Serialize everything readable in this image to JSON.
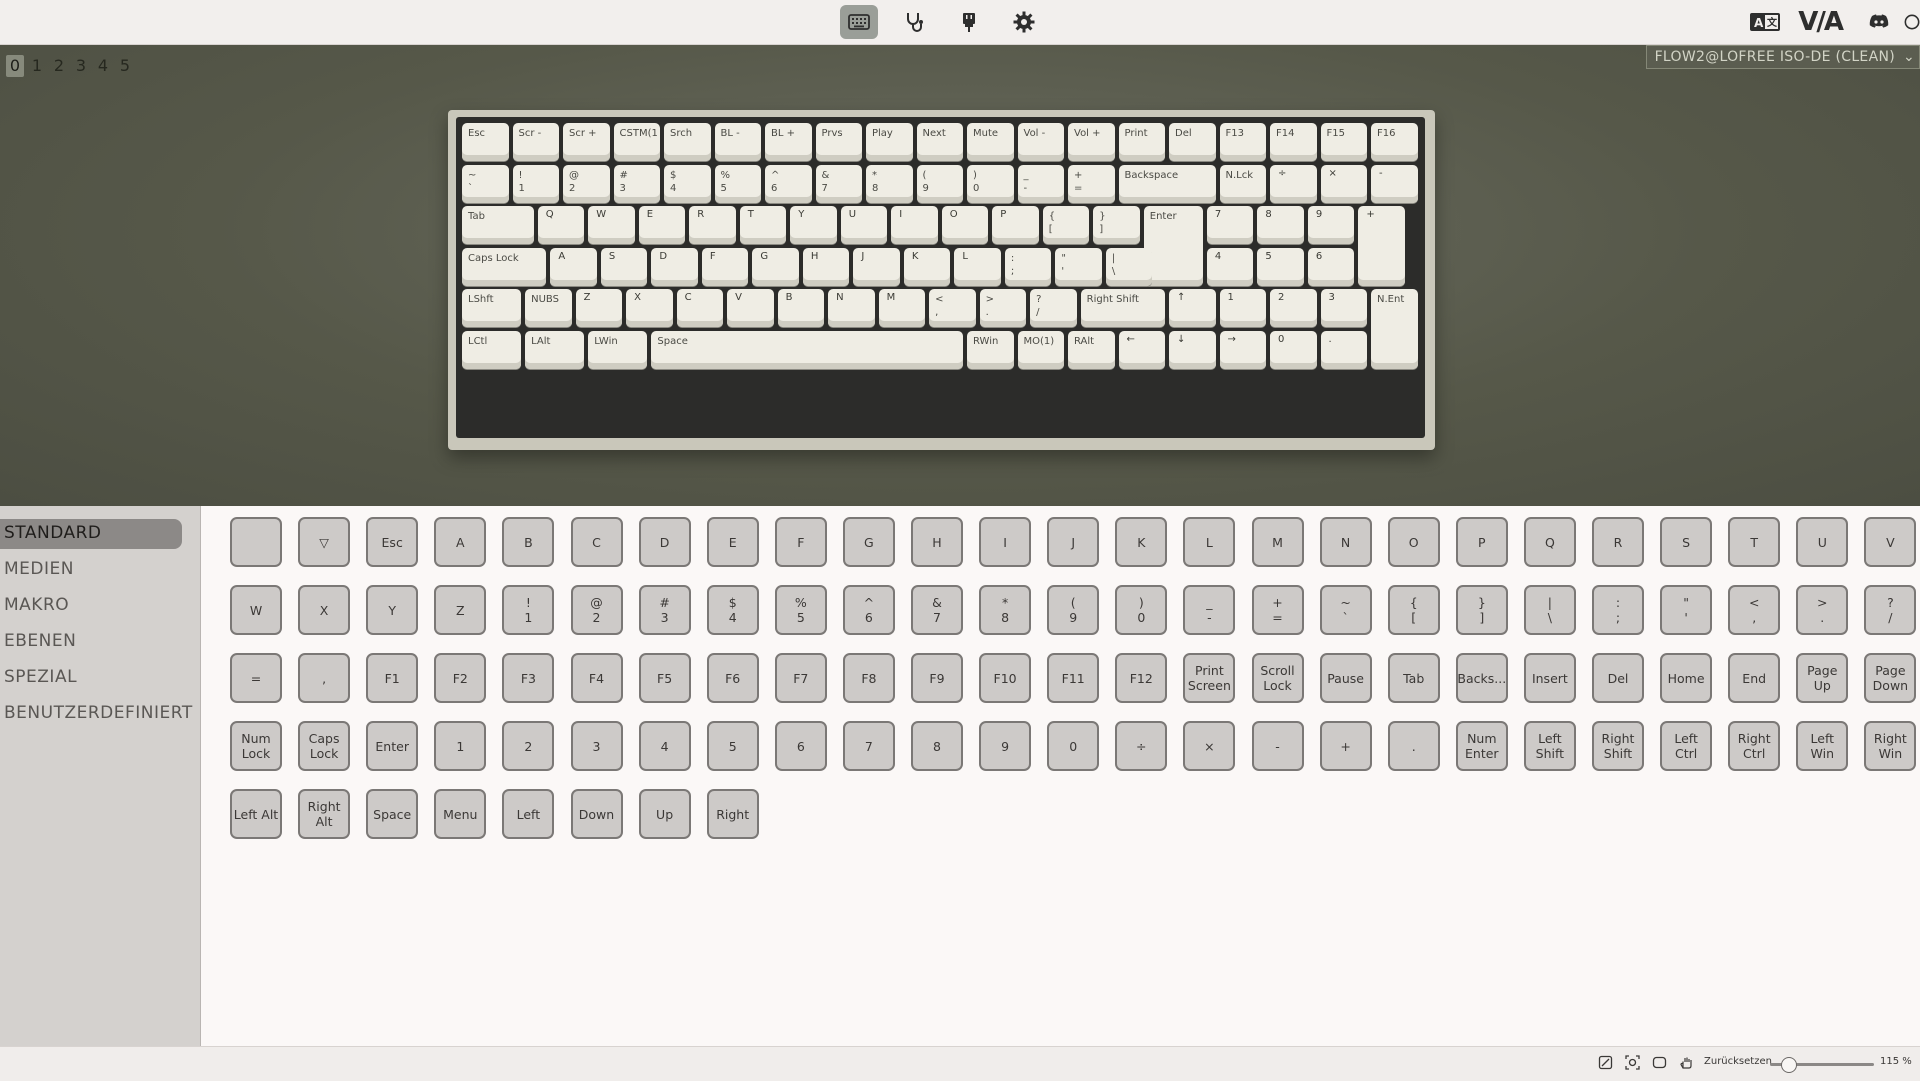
{
  "topbar": {
    "nav": [
      {
        "name": "keyboard-icon",
        "active": true
      },
      {
        "name": "stethoscope-icon",
        "active": false
      },
      {
        "name": "plug-icon",
        "active": false
      },
      {
        "name": "gear-icon",
        "active": false
      }
    ],
    "brand": "V/A"
  },
  "layers": [
    "0",
    "1",
    "2",
    "3",
    "4",
    "5"
  ],
  "active_layer": "0",
  "device": "FLOW2@LOFREE ISO-DE (CLEAN)",
  "keyboard_rows": [
    [
      [
        "Esc",
        ""
      ],
      [
        "Scr -",
        ""
      ],
      [
        "Scr +",
        ""
      ],
      [
        "CSTM(1",
        ""
      ],
      [
        "Srch",
        ""
      ],
      [
        "BL -",
        ""
      ],
      [
        "BL +",
        ""
      ],
      [
        "Prvs",
        ""
      ],
      [
        "Play",
        ""
      ],
      [
        "Next",
        ""
      ],
      [
        "Mute",
        ""
      ],
      [
        "Vol -",
        ""
      ],
      [
        "Vol +",
        ""
      ],
      [
        "Print",
        ""
      ],
      [
        "Del",
        ""
      ],
      [
        "F13",
        ""
      ],
      [
        "F14",
        ""
      ],
      [
        "F15",
        ""
      ],
      [
        "F16",
        ""
      ]
    ],
    [
      [
        "~",
        "`"
      ],
      [
        "!",
        "1"
      ],
      [
        "@",
        "2"
      ],
      [
        "#",
        "3"
      ],
      [
        "$",
        "4"
      ],
      [
        "%",
        "5"
      ],
      [
        "^",
        "6"
      ],
      [
        "&",
        "7"
      ],
      [
        "*",
        "8"
      ],
      [
        "(",
        "9"
      ],
      [
        ")",
        "0"
      ],
      [
        "_",
        "-"
      ],
      [
        "+",
        "="
      ],
      [
        "Backspace",
        ""
      ],
      [
        "N.Lck",
        ""
      ],
      [
        "÷",
        ""
      ],
      [
        "×",
        ""
      ],
      [
        "-",
        ""
      ]
    ],
    [
      [
        "Tab",
        ""
      ],
      [
        "Q",
        ""
      ],
      [
        "W",
        ""
      ],
      [
        "E",
        ""
      ],
      [
        "R",
        ""
      ],
      [
        "T",
        ""
      ],
      [
        "Y",
        ""
      ],
      [
        "U",
        ""
      ],
      [
        "I",
        ""
      ],
      [
        "O",
        ""
      ],
      [
        "P",
        ""
      ],
      [
        "{",
        "["
      ],
      [
        "}",
        "]"
      ],
      [
        "Enter",
        ""
      ],
      [
        "7",
        ""
      ],
      [
        "8",
        ""
      ],
      [
        "9",
        ""
      ],
      [
        "+",
        ""
      ]
    ],
    [
      [
        "Caps Lock",
        ""
      ],
      [
        "A",
        ""
      ],
      [
        "S",
        ""
      ],
      [
        "D",
        ""
      ],
      [
        "F",
        ""
      ],
      [
        "G",
        ""
      ],
      [
        "H",
        ""
      ],
      [
        "J",
        ""
      ],
      [
        "K",
        ""
      ],
      [
        "L",
        ""
      ],
      [
        ":",
        ";"
      ],
      [
        "\"",
        "'"
      ],
      [
        "|",
        "\\"
      ],
      [
        "4",
        ""
      ],
      [
        "5",
        ""
      ],
      [
        "6",
        ""
      ]
    ],
    [
      [
        "LShft",
        ""
      ],
      [
        "NUBS",
        ""
      ],
      [
        "Z",
        ""
      ],
      [
        "X",
        ""
      ],
      [
        "C",
        ""
      ],
      [
        "V",
        ""
      ],
      [
        "B",
        ""
      ],
      [
        "N",
        ""
      ],
      [
        "M",
        ""
      ],
      [
        "<",
        ","
      ],
      [
        ">",
        "."
      ],
      [
        "?",
        "/"
      ],
      [
        "Right Shift",
        ""
      ],
      [
        "↑",
        ""
      ],
      [
        "1",
        ""
      ],
      [
        "2",
        ""
      ],
      [
        "3",
        ""
      ],
      [
        "N.Ent",
        ""
      ]
    ],
    [
      [
        "LCtl",
        ""
      ],
      [
        "LAlt",
        ""
      ],
      [
        "LWin",
        ""
      ],
      [
        "Space",
        ""
      ],
      [
        "RWin",
        ""
      ],
      [
        "MO(1)",
        ""
      ],
      [
        "RAlt",
        ""
      ],
      [
        "←",
        ""
      ],
      [
        "↓",
        ""
      ],
      [
        "→",
        ""
      ],
      [
        "0",
        ""
      ],
      [
        ".",
        ""
      ]
    ]
  ],
  "menu": {
    "items": [
      "STANDARD",
      "MEDIEN",
      "MAKRO",
      "EBENEN",
      "SPEZIAL",
      "BENUTZERDEFINIERT"
    ],
    "active": "STANDARD"
  },
  "keycodes": [
    [
      "",
      "▽",
      "Esc",
      "A",
      "B",
      "C",
      "D",
      "E",
      "F",
      "G",
      "H",
      "I",
      "J",
      "K",
      "L",
      "M",
      "N",
      "O",
      "P",
      "Q",
      "R",
      "S",
      "T",
      "U",
      "V"
    ],
    [
      "W",
      "X",
      "Y",
      "Z",
      "!\n1",
      "@\n2",
      "#\n3",
      "$\n4",
      "%\n5",
      "^\n6",
      "&\n7",
      "*\n8",
      "(\n9",
      ")\n0",
      "_\n-",
      "+\n=",
      "~\n`",
      "{\n[",
      "}\n]",
      "|\n\\",
      ":\n;",
      "\"\n'",
      "<\n,",
      ">\n.",
      "?\n/"
    ],
    [
      "=",
      ",",
      "F1",
      "F2",
      "F3",
      "F4",
      "F5",
      "F6",
      "F7",
      "F8",
      "F9",
      "F10",
      "F11",
      "F12",
      "Print\nScreen",
      "Scroll\nLock",
      "Pause",
      "Tab",
      "Backs...",
      "Insert",
      "Del",
      "Home",
      "End",
      "Page\nUp",
      "Page\nDown"
    ],
    [
      "Num\nLock",
      "Caps\nLock",
      "Enter",
      "1",
      "2",
      "3",
      "4",
      "5",
      "6",
      "7",
      "8",
      "9",
      "0",
      "÷",
      "×",
      "-",
      "+",
      ".",
      "Num\nEnter",
      "Left\nShift",
      "Right\nShift",
      "Left Ctrl",
      "Right\nCtrl",
      "Left\nWin",
      "Right\nWin"
    ],
    [
      "Left Alt",
      "Right\nAlt",
      "Space",
      "Menu",
      "Left",
      "Down",
      "Up",
      "Right"
    ]
  ],
  "statusbar": {
    "reset_label": "Zurücksetzen",
    "zoom": "115 %",
    "zoom_level": 0.17
  }
}
